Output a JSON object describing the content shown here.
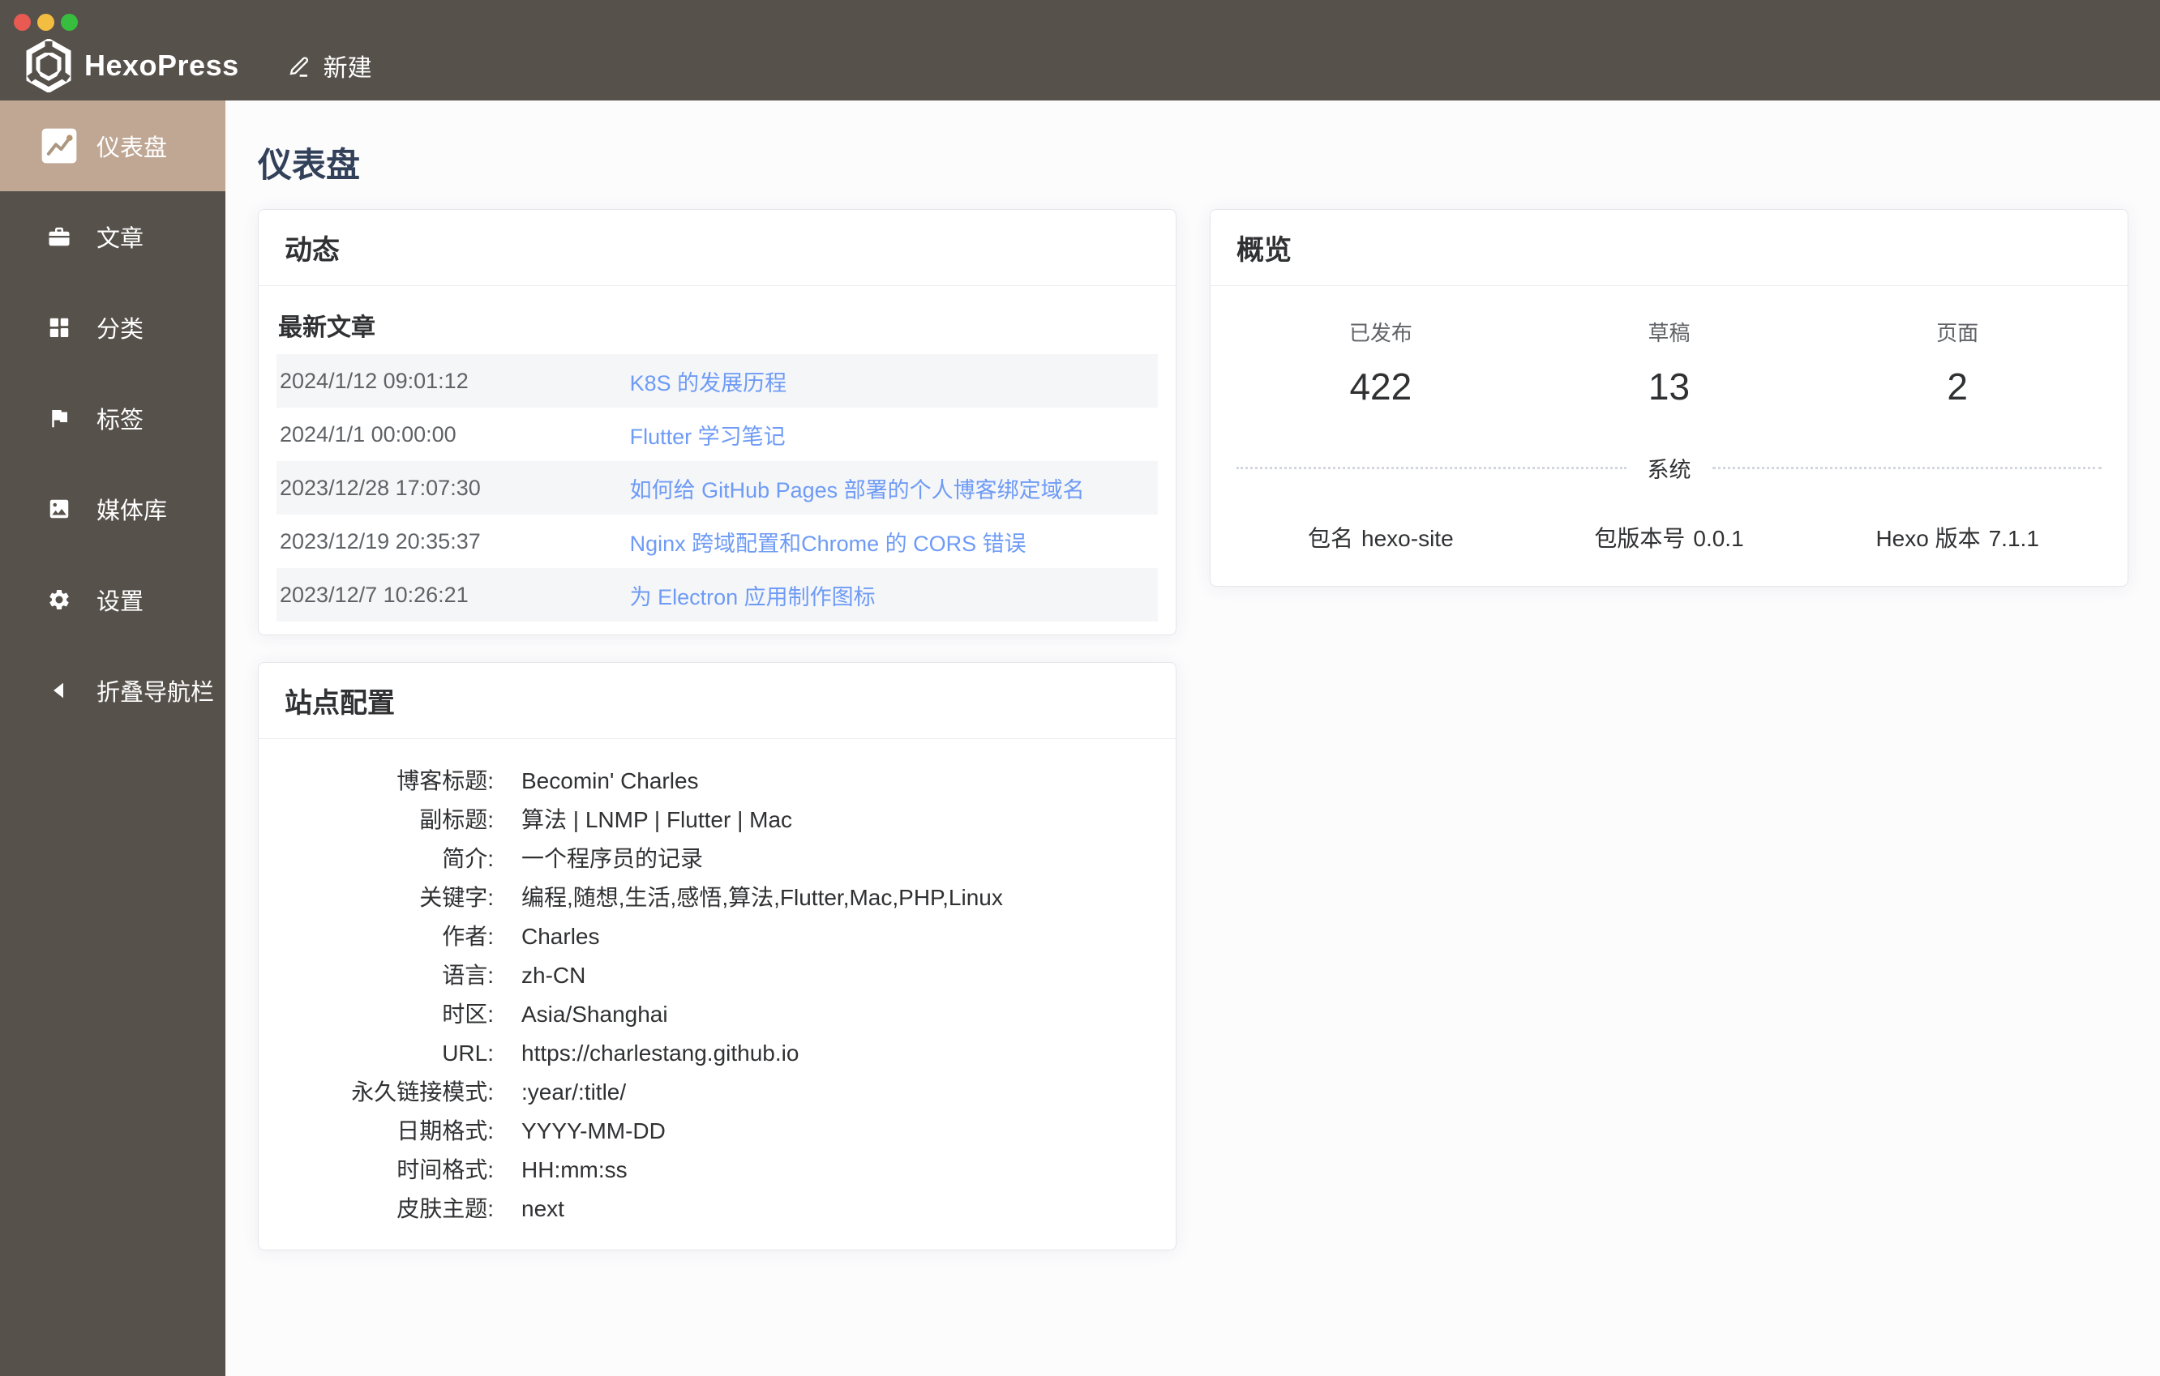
{
  "window": {
    "traffic_lights": {
      "close": "#e85a52",
      "minimize": "#f3bd42",
      "zoom": "#38be3e"
    }
  },
  "topbar": {
    "app_name": "HexoPress",
    "new_label": "新建"
  },
  "sidebar": {
    "items": [
      {
        "label": "仪表盘",
        "icon": "dashboard-icon",
        "active": true
      },
      {
        "label": "文章",
        "icon": "posts-icon",
        "active": false
      },
      {
        "label": "分类",
        "icon": "categories-icon",
        "active": false
      },
      {
        "label": "标签",
        "icon": "tags-icon",
        "active": false
      },
      {
        "label": "媒体库",
        "icon": "media-icon",
        "active": false
      },
      {
        "label": "设置",
        "icon": "settings-icon",
        "active": false
      },
      {
        "label": "折叠导航栏",
        "icon": "collapse-icon",
        "active": false
      }
    ]
  },
  "page": {
    "title": "仪表盘"
  },
  "activity": {
    "card_title": "动态",
    "section_title": "最新文章",
    "posts": [
      {
        "date": "2024/1/12 09:01:12",
        "title": "K8S 的发展历程"
      },
      {
        "date": "2024/1/1 00:00:00",
        "title": "Flutter 学习笔记"
      },
      {
        "date": "2023/12/28 17:07:30",
        "title": "如何给 GitHub Pages 部署的个人博客绑定域名"
      },
      {
        "date": "2023/12/19 20:35:37",
        "title": "Nginx 跨域配置和Chrome 的 CORS 错误"
      },
      {
        "date": "2023/12/7 10:26:21",
        "title": "为 Electron 应用制作图标"
      }
    ]
  },
  "overview": {
    "card_title": "概览",
    "stats": [
      {
        "label": "已发布",
        "value": "422"
      },
      {
        "label": "草稿",
        "value": "13"
      },
      {
        "label": "页面",
        "value": "2"
      }
    ],
    "divider_label": "系统",
    "system": [
      {
        "label": "包名",
        "value": "hexo-site"
      },
      {
        "label": "包版本号",
        "value": "0.0.1"
      },
      {
        "label": "Hexo 版本",
        "value": "7.1.1"
      }
    ]
  },
  "site_config": {
    "card_title": "站点配置",
    "rows": [
      {
        "label": "博客标题:",
        "value": "Becomin' Charles"
      },
      {
        "label": "副标题:",
        "value": "算法 | LNMP | Flutter | Mac"
      },
      {
        "label": "简介:",
        "value": "一个程序员的记录"
      },
      {
        "label": "关键字:",
        "value": "编程,随想,生活,感悟,算法,Flutter,Mac,PHP,Linux"
      },
      {
        "label": "作者:",
        "value": "Charles"
      },
      {
        "label": "语言:",
        "value": "zh-CN"
      },
      {
        "label": "时区:",
        "value": "Asia/Shanghai"
      },
      {
        "label": "URL:",
        "value": "https://charlestang.github.io"
      },
      {
        "label": "永久链接模式:",
        "value": ":year/:title/"
      },
      {
        "label": "日期格式:",
        "value": "YYYY-MM-DD"
      },
      {
        "label": "时间格式:",
        "value": "HH:mm:ss"
      },
      {
        "label": "皮肤主题:",
        "value": "next"
      }
    ]
  },
  "colors": {
    "topbar_bg": "#56514b",
    "sidebar_bg": "#56514b",
    "active_item_bg": "#bfa794",
    "link_blue": "#6e9bf5",
    "page_title": "#33405a",
    "row_stripe": "#f5f6f8",
    "text_dark": "#303133",
    "text_gray": "#5f6266"
  }
}
